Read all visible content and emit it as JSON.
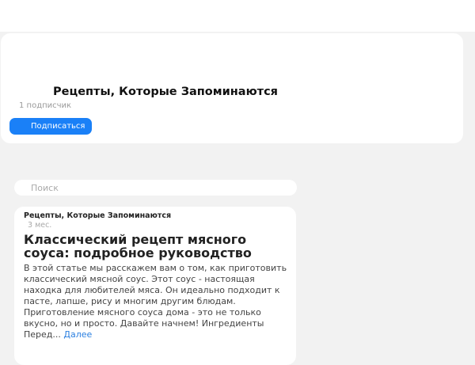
{
  "channel": {
    "title": "Рецепты, Которые Запоминаются",
    "subscribers": "1 подписчик",
    "subscribe_label": "Подписаться",
    "accent": "#1a80f7"
  },
  "search": {
    "placeholder": "Поиск",
    "value": ""
  },
  "feed": [
    {
      "author": "Рецепты, Которые Запоминаются",
      "time": "3 мес.",
      "title": "Классический рецепт мясного соуса: подробное руководство",
      "excerpt": "В этой статье мы расскажем вам о том, как приготовить классический мясной соус. Этот соус - настоящая находка для любителей мяса. Он идеально подходит к пасте, лапше, рису и многим другим блюдам. Приготовление мясного соуса дома - это не только вкусно, но и просто. Давайте начнем! Ингредиенты Перед...",
      "more": "Далее"
    }
  ]
}
